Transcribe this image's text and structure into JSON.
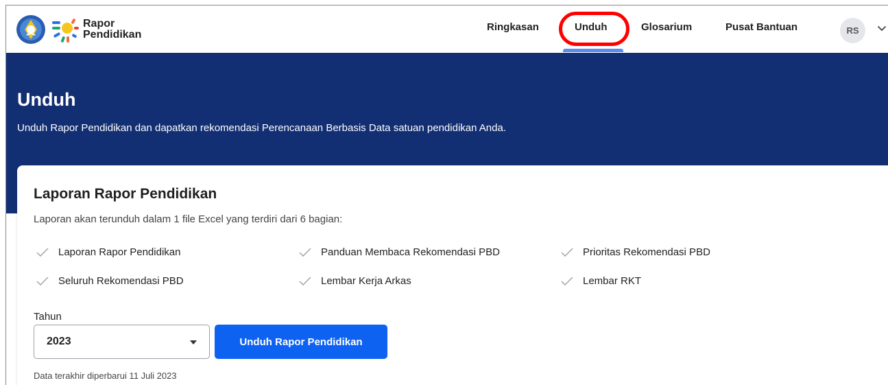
{
  "header": {
    "brand_line1": "Rapor",
    "brand_line2": "Pendidikan",
    "nav": [
      {
        "label": "Ringkasan"
      },
      {
        "label": "Unduh",
        "active": true
      },
      {
        "label": "Glosarium"
      },
      {
        "label": "Pusat Bantuan"
      }
    ],
    "avatar_initials": "RS",
    "icons": {
      "emblem": "tut-wuri-handayani-emblem",
      "logo": "rapor-pendidikan-sun-logo",
      "menu": "chevron-down-icon"
    },
    "highlight_color": "#ff0000"
  },
  "hero": {
    "title": "Unduh",
    "subtitle": "Unduh Rapor Pendidikan dan dapatkan rekomendasi Perencanaan Berbasis Data satuan pendidikan Anda.",
    "background": "#132f73"
  },
  "card": {
    "title": "Laporan Rapor Pendidikan",
    "description": "Laporan akan terunduh dalam 1 file Excel yang terdiri dari 6 bagian:",
    "parts": [
      "Laporan Rapor Pendidikan",
      "Panduan Membaca Rekomendasi PBD",
      "Prioritas Rekomendasi PBD",
      "Seluruh Rekomendasi PBD",
      "Lembar Kerja Arkas",
      "Lembar RKT"
    ],
    "year_label": "Tahun",
    "year_value": "2023",
    "download_button": "Unduh Rapor Pendidikan",
    "button_color": "#0d62f2",
    "updated_text": "Data terakhir diperbarui 11 Juli 2023"
  }
}
